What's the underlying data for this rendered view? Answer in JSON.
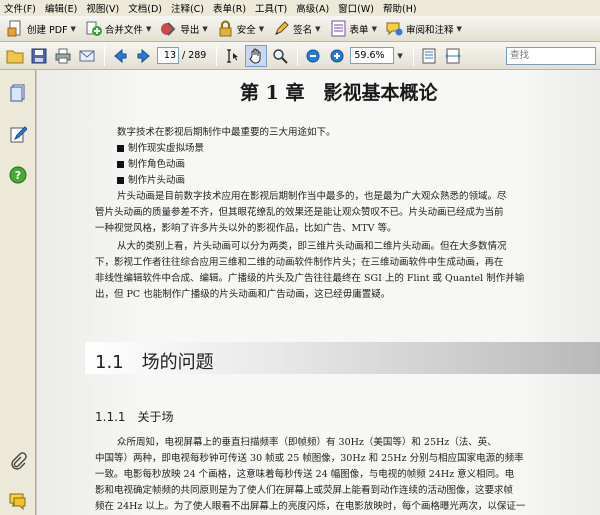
{
  "menu": [
    "文件(F)",
    "编辑(E)",
    "视图(V)",
    "文档(D)",
    "注释(C)",
    "表单(R)",
    "工具(T)",
    "高级(A)",
    "窗口(W)",
    "帮助(H)"
  ],
  "toolbar1": {
    "create_pdf": "创建 PDF",
    "merge_files": "合并文件",
    "export": "导出",
    "security": "安全",
    "sign": "签名",
    "forms": "表单",
    "review": "审阅和注释"
  },
  "toolbar2": {
    "page_current": "13",
    "page_total": "/ 289",
    "zoom": "59.6%",
    "find_placeholder": "查找"
  },
  "document": {
    "chapter_title": "第 1 章　影视基本概论",
    "intro": "数字技术在影视后期制作中最重要的三大用途如下。",
    "bullets": [
      "制作现实虚拟场景",
      "制作角色动画",
      "制作片头动画"
    ],
    "para1": [
      "片头动画是目前数字技术应用在影视后期制作当中最多的，也是最为广大观众熟悉的领域。尽",
      "管片头动画的质量参差不齐，但其眼花缭乱的效果还是能让观众赞叹不已。片头动画已经成为当前",
      "一种视觉风格，影响了许多片头以外的影视作品，比如广告、MTV 等。"
    ],
    "para2": [
      "从大的类别上看，片头动画可以分为两类，即三维片头动画和二维片头动画。但在大多数情况",
      "下，影视工作者往往综合应用三维和二维的动画软件制作片头；在三维动画软件中生成动画，再在",
      "非线性编辑软件中合成、编辑。广播级的片头及广告往往最终在 SGI 上的 Flint 或 Quantel 制作并输",
      "出，但 PC 也能制作广播级的片头动画和广告动画，这已经毋庸置疑。"
    ],
    "section_title": "1.1　场的问题",
    "subsection_title": "1.1.1　关于场",
    "para3": [
      "众所周知，电视屏幕上的垂直扫描频率（即帧频）有 30Hz（美国等）和 25Hz（法、英、",
      "中国等）两种，即电视每秒钟可传送 30 帧或 25 帧图像，30Hz 和 25Hz 分别与相应国家电源的频率",
      "一致。电影每秒放映 24 个画格，这意味着每秒传送 24 幅图像，与电视的帧频 24Hz 意义相同。电",
      "影和电视确定帧频的共同原则是为了使人们在屏幕上或荧屏上能看到动作连续的活动图像，这要求帧",
      "频在 24Hz 以上。为了使人眼看不出屏幕上的亮度闪烁，在电影放映时，每个画格曝光两次，以保证一"
    ]
  }
}
